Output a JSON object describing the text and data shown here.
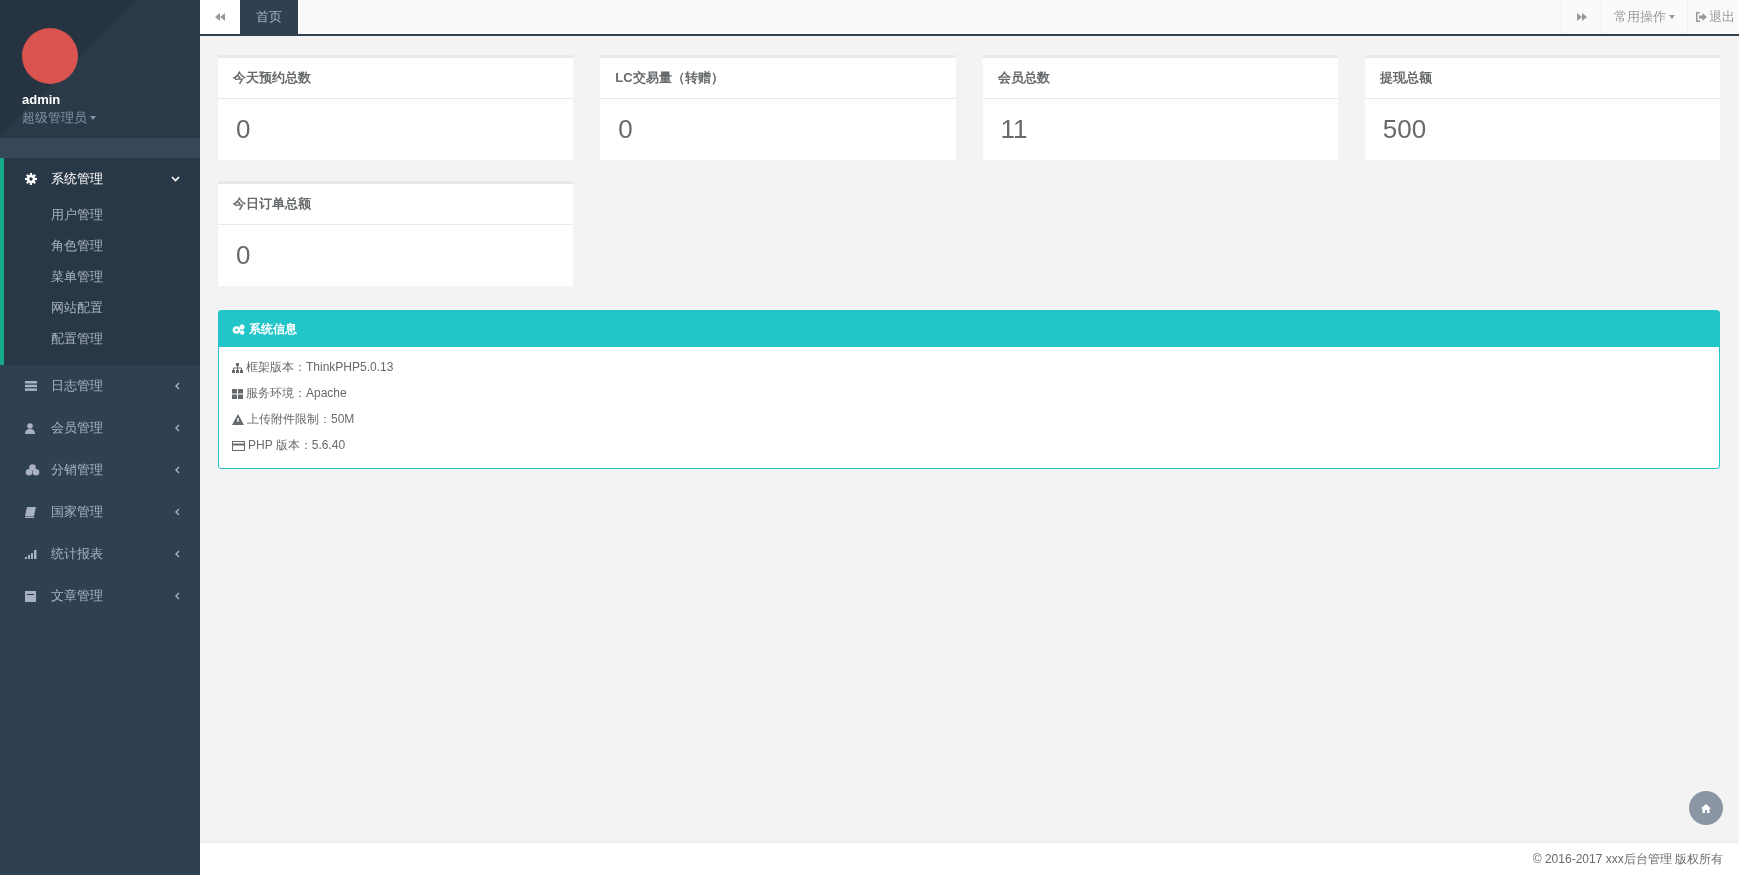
{
  "sidebar": {
    "user": {
      "name": "admin",
      "role": "超级管理员"
    },
    "menu": [
      {
        "label": "系统管理",
        "expanded": true,
        "children": [
          {
            "label": "用户管理"
          },
          {
            "label": "角色管理"
          },
          {
            "label": "菜单管理"
          },
          {
            "label": "网站配置"
          },
          {
            "label": "配置管理"
          }
        ]
      },
      {
        "label": "日志管理",
        "expanded": false
      },
      {
        "label": "会员管理",
        "expanded": false
      },
      {
        "label": "分销管理",
        "expanded": false
      },
      {
        "label": "国家管理",
        "expanded": false
      },
      {
        "label": "统计报表",
        "expanded": false
      },
      {
        "label": "文章管理",
        "expanded": false
      }
    ]
  },
  "topbar": {
    "tabs": [
      {
        "label": "首页",
        "selected": true
      }
    ],
    "actions_menu": "常用操作",
    "logout": "退出"
  },
  "stats": [
    {
      "title": "今天预约总数",
      "value": "0"
    },
    {
      "title": "LC交易量（转赠）",
      "value": "0"
    },
    {
      "title": "会员总数",
      "value": "11"
    },
    {
      "title": "提现总额",
      "value": "500"
    },
    {
      "title": "今日订单总额",
      "value": "0"
    }
  ],
  "system_info": {
    "title": "系统信息",
    "rows": [
      "框架版本：ThinkPHP5.0.13",
      "服务环境：Apache",
      "上传附件限制：50M",
      "PHP 版本：5.6.40"
    ]
  },
  "footer": "© 2016-2017 xxx后台管理 版权所有"
}
